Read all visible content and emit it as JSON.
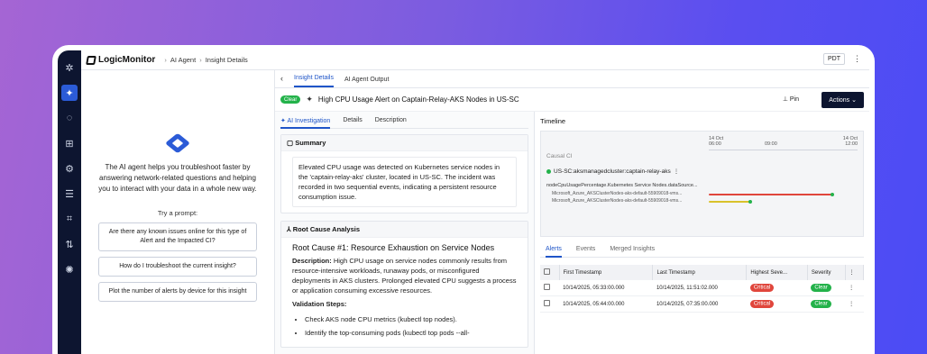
{
  "app": {
    "logo_text": "LogicMonitor",
    "breadcrumbs": [
      "AI Agent",
      "Insight Details"
    ],
    "timezone": "PDT"
  },
  "rail_icons": [
    "logo-icon",
    "ai-sparkle-icon",
    "lightbulb-icon",
    "dashboard-icon",
    "settings-gear-icon",
    "list-icon",
    "topology-icon",
    "sort-icon",
    "cog-icon"
  ],
  "assistant": {
    "intro": "The AI agent helps you troubleshoot faster by answering network-related questions and helping you to interact with your data in a whole new way.",
    "try_label": "Try a prompt:",
    "prompts": [
      "Are there any known issues online for this type of Alert and the Impacted CI?",
      "How do I troubleshoot the current insight?",
      "Plot the number of alerts by device for this insight"
    ]
  },
  "insight": {
    "tabs": [
      "Insight Details",
      "AI Agent Output"
    ],
    "status_badge": "Clear",
    "title": "High CPU Usage Alert on Captain-Relay-AKS Nodes in US-SC",
    "pin_label": "Pin",
    "actions_label": "Actions"
  },
  "investigation": {
    "tabs": [
      "AI Investigation",
      "Details",
      "Description"
    ],
    "summary_heading": "Summary",
    "summary_text": "Elevated CPU usage was detected on Kubernetes service nodes in the 'captain-relay-aks' cluster, located in US-SC. The incident was recorded in two sequential events, indicating a persistent resource consumption issue.",
    "rca_heading": "Root Cause Analysis",
    "rc_title": "Root Cause #1: Resource Exhaustion on Service Nodes",
    "rc_desc_label": "Description:",
    "rc_desc": " High CPU usage on service nodes commonly results from resource-intensive workloads, runaway pods, or misconfigured deployments in AKS clusters. Prolonged elevated CPU suggests a process or application consuming excessive resources.",
    "validation_label": "Validation Steps:",
    "steps": [
      "Check AKS node CPU metrics (kubectl top nodes).",
      "Identify the top-consuming pods (kubectl top pods --all-"
    ]
  },
  "timeline": {
    "label": "Timeline",
    "ticks": [
      {
        "top": "14 Oct",
        "bottom": "06:00"
      },
      {
        "top": "",
        "bottom": "09:00"
      },
      {
        "top": "14 Oct",
        "bottom": "12:00"
      }
    ],
    "ci_label": "Causal CI",
    "host": "US-SC:aksmanagedcluster:captain-relay-aks",
    "datasource": "nodeCpuUsagePercentage.Kubernetes Service Nodes.dataSource...",
    "instances": [
      {
        "name": "Microsoft_Azure_AKSClusterNodes-aks-default-55909018-vms...",
        "color": "#e0463c",
        "start_frac": 0.0,
        "end_frac": 0.97
      },
      {
        "name": "Microsoft_Azure_AKSClusterNodes-aks-default-55909018-vms...",
        "color": "#d9c22a",
        "start_frac": 0.0,
        "end_frac": 0.32
      }
    ]
  },
  "alerts": {
    "tabs": [
      "Alerts",
      "Events",
      "Merged Insights"
    ],
    "columns": [
      "First Timestamp",
      "Last Timestamp",
      "Highest Seve...",
      "Severity"
    ],
    "rows": [
      {
        "first": "10/14/2025, 05:33:00.000",
        "last": "10/14/2025, 11:51:02.000",
        "highest": "Critical",
        "severity": "Clear"
      },
      {
        "first": "10/14/2025, 05:44:00.000",
        "last": "10/14/2025, 07:35:00.000",
        "highest": "Critical",
        "severity": "Clear"
      }
    ]
  },
  "colors": {
    "accent": "#1f55c8",
    "rail": "#0d1530",
    "critical": "#e0463c",
    "clear": "#23b24a"
  }
}
